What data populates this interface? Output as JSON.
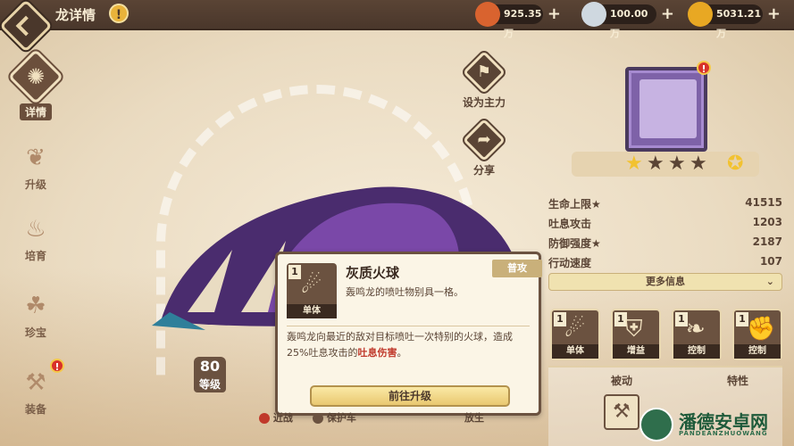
{
  "header": {
    "title": "龙详情",
    "warn_glyph": "!",
    "resources": [
      {
        "name": "meat",
        "value": "925.35万",
        "color": "#d9632f"
      },
      {
        "name": "crystal",
        "value": "100.00万",
        "color": "#cfd8e0"
      },
      {
        "name": "gold",
        "value": "5031.21万",
        "color": "#e8a823"
      }
    ],
    "plus": "+"
  },
  "nav": {
    "items": [
      {
        "label": "详情",
        "icon": "snail-gear-icon"
      },
      {
        "label": "升级",
        "icon": "dragonfruit-icon"
      },
      {
        "label": "培育",
        "icon": "flame-icon"
      },
      {
        "label": "珍宝",
        "icon": "triquetra-icon"
      },
      {
        "label": "装备",
        "icon": "axe-icon"
      }
    ]
  },
  "actions": {
    "set_main": "设为主力",
    "share": "分享"
  },
  "dragon": {
    "level": "80",
    "level_unit": "等级"
  },
  "stars": {
    "filled": 1,
    "total": 4
  },
  "stats": [
    {
      "label": "生命上限★",
      "value": "41515"
    },
    {
      "label": "吐息攻击",
      "value": "1203"
    },
    {
      "label": "防御强度★",
      "value": "2187"
    },
    {
      "label": "行动速度",
      "value": "107"
    }
  ],
  "more_info": "更多信息",
  "skills": [
    {
      "num": "1",
      "label": "单体"
    },
    {
      "num": "1",
      "label": "增益"
    },
    {
      "num": "1",
      "label": "控制"
    },
    {
      "num": "1",
      "label": "控制"
    }
  ],
  "passive": {
    "left": "被动",
    "right": "特性"
  },
  "popup": {
    "num": "1",
    "type_label": "单体",
    "name": "灰质火球",
    "short_desc": "轰鸣龙的喷吐物别具一格。",
    "tag": "普攻",
    "body_pre": "轰鸣龙向最近的敌对目标喷吐一次特别的火球，造成25%吐息攻击的",
    "body_hl": "吐息伤害",
    "body_post": "。",
    "upgrade_button": "前往升级"
  },
  "bottom": {
    "tag1": "近战",
    "tag2": "保护车",
    "tag3": "放生"
  },
  "watermark": {
    "text": "潘德安卓网",
    "sub": "PANDEANZHUOWANG"
  }
}
